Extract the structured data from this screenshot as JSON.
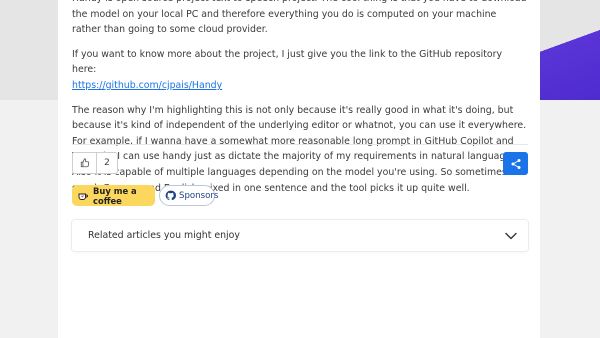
{
  "article": {
    "para1": "Handy is open source project text to speech project. The cool thing is that you have to download the model on your local PC and therefore everything you do is computed on your machine rather than going to some cloud provider.",
    "para2_intro": "If you want to know more about the project, I just give you the link to the GitHub repository here:",
    "link_text": "https://github.com/cjpais/Handy",
    "para3": "The reason why I'm highlighting this is not only because it's really good in what it's doing, but because it's kind of independent of the underlying editor or whatnot, you can use it everywhere. For example, if I wanna have a somewhat more reasonable long prompt in GitHub Copilot and VS Code, I can use handy just as dictate the majority of my requirements in natural language. Also it is capable of multiple languages depending on the model you're using. So sometimes I speak German and English mixed in one sentence and the tool picks it up quite well."
  },
  "reactions": {
    "like_count": "2"
  },
  "support": {
    "coffee_label": "Buy me a coffee",
    "sponsors_label": "Sponsors"
  },
  "related": {
    "label": "Related articles you might enjoy"
  },
  "icons": {
    "like": "thumbs-up-icon",
    "share": "share-icon",
    "coffee": "coffee-cup-icon",
    "github": "github-icon",
    "chevron": "chevron-down-icon"
  },
  "colors": {
    "accent_blue": "#1a73e8",
    "coffee_yellow": "#fbd75e",
    "hero_purple": "#5a34d6"
  }
}
